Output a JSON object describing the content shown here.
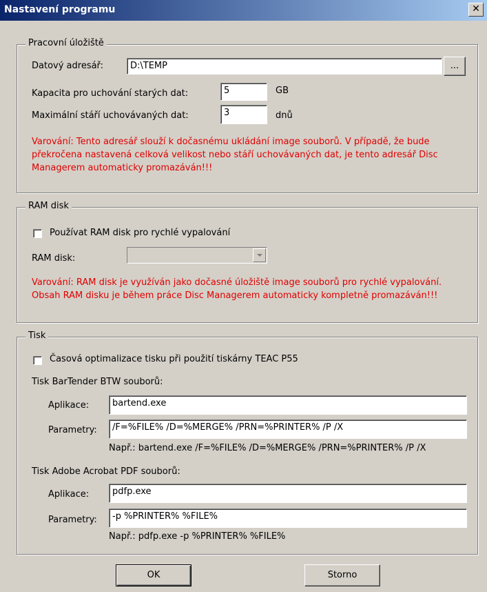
{
  "window": {
    "title": "Nastavení programu",
    "close_label": "x"
  },
  "storage": {
    "legend": "Pracovní úložiště",
    "data_dir_label": "Datový adresář:",
    "data_dir_value": "D:\\TEMP",
    "browse_label": "...",
    "capacity_label": "Kapacita pro uchování starých dat:",
    "capacity_value": "5",
    "capacity_unit": "GB",
    "max_age_label": "Maximální stáří uchovávaných dat:",
    "max_age_value": "3",
    "max_age_unit": "dnů",
    "warning_lines": [
      "Varování: Tento adresář slouží k dočasnému ukládání image souborů. V případě, že bude",
      "překročena nastavená celková velikost nebo stáří uchovávaných dat, je tento adresář Disc",
      "Managerem automaticky promazáván!!!"
    ]
  },
  "ramdisk": {
    "legend": "RAM disk",
    "use_label": "Používat RAM disk pro rychlé vypalování",
    "use_checked": false,
    "disk_label": "RAM disk:",
    "disk_value": "",
    "warning_lines": [
      "Varování: RAM disk je využíván jako dočasné úložiště image souborů pro rychlé vypalování.",
      "Obsah RAM disku je během práce Disc Managerem automaticky kompletně promazáván!!!"
    ]
  },
  "print": {
    "legend": "Tisk",
    "optimize_label": "Časová optimalizace tisku při použití tiskárny TEAC P55",
    "optimize_checked": false,
    "bartender_heading": "Tisk BarTender BTW souborů:",
    "bt_app_label": "Aplikace:",
    "bt_app_value": "bartend.exe",
    "bt_params_label": "Parametry:",
    "bt_params_value": "/F=%FILE% /D=%MERGE% /PRN=%PRINTER% /P /X",
    "bt_example": "Např.: bartend.exe /F=%FILE% /D=%MERGE% /PRN=%PRINTER% /P /X",
    "pdf_heading": "Tisk Adobe Acrobat PDF souborů:",
    "pdf_app_label": "Aplikace:",
    "pdf_app_value": "pdfp.exe",
    "pdf_params_label": "Parametry:",
    "pdf_params_value": "-p %PRINTER% %FILE%",
    "pdf_example": "Např.: pdfp.exe -p %PRINTER% %FILE%"
  },
  "buttons": {
    "ok_label": "OK",
    "cancel_label": "Storno"
  }
}
